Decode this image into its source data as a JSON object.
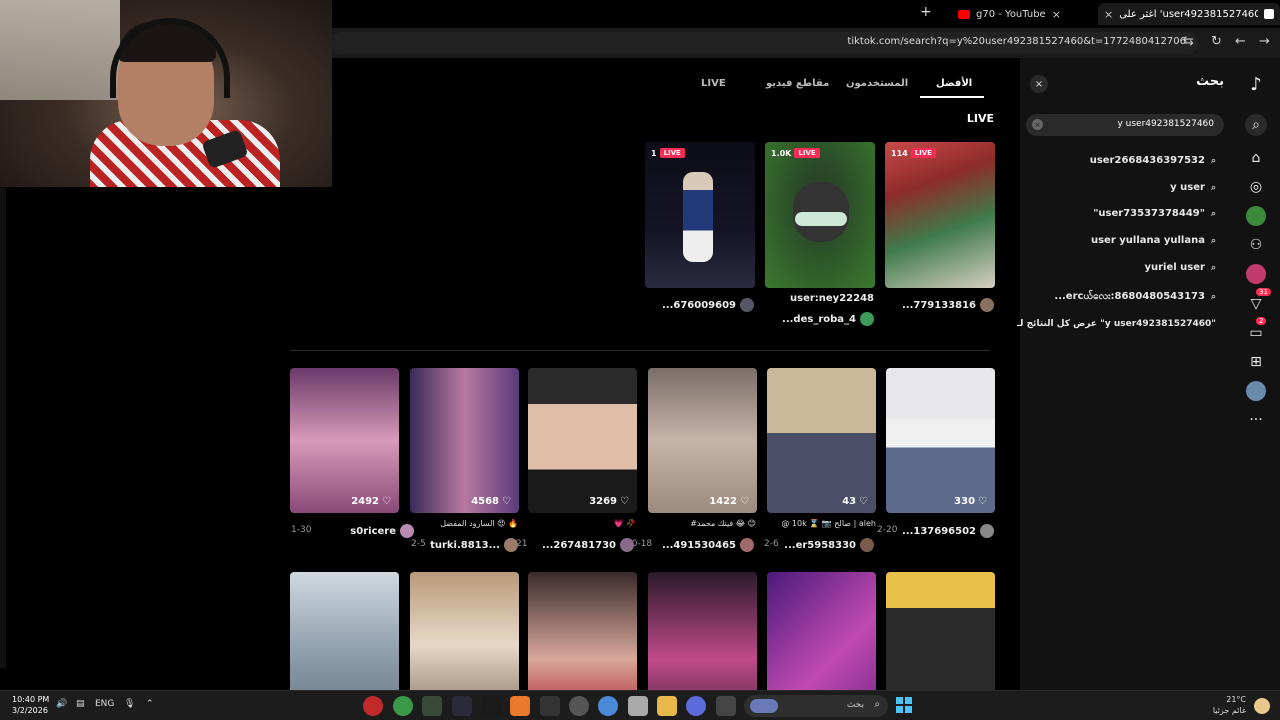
{
  "browser": {
    "tabs": [
      {
        "id": "tiktok",
        "label": "اغثر على 'user492381527460 y'"
      },
      {
        "id": "youtube",
        "label": "g70 - YouTube"
      }
    ],
    "new_tab_symbol": "+",
    "close_symbol": "×",
    "url": "tiktok.com/search?q=y%20user492381527460&t=1772480412706"
  },
  "search_panel": {
    "title": "بحث",
    "close_symbol": "×",
    "query": "y user492381527460",
    "clear_symbol": "×",
    "suggestions": [
      "user2668436397532",
      "y user",
      "\"user73537378449\"",
      "user yullana yullana",
      "yuriel user",
      "...ercယ်လေး:8680480543173"
    ],
    "see_all": "عرض كل النتائج لـ \"y user492381527460\""
  },
  "rail": {
    "messages_badge": "2",
    "inbox_badge": "31",
    "more_symbol": "···"
  },
  "main": {
    "tabs": [
      {
        "id": "top",
        "label": "الأفضل"
      },
      {
        "id": "users",
        "label": "المستخدمون"
      },
      {
        "id": "videos",
        "label": "مقاطع فيديو"
      },
      {
        "id": "live",
        "label": "LIVE"
      }
    ],
    "live_heading": "LIVE",
    "live_cards": [
      {
        "count": "114",
        "tag": "LIVE",
        "name": "...779133816"
      },
      {
        "count": "1.0K",
        "tag": "LIVE",
        "name": "user:ney22248",
        "name2": "...des_roba_4"
      },
      {
        "count": "1",
        "tag": "LIVE",
        "name": "...676009609"
      }
    ],
    "videos": [
      {
        "likes": "330",
        "caption": "",
        "user": "...137696502",
        "date": "2-20"
      },
      {
        "likes": "43",
        "caption": "@ 10k ⌛ 📷 صالح | aleh",
        "user": "...er5958330",
        "date": "2-6"
      },
      {
        "likes": "1422",
        "caption": "#فيتك محمد 😂 😊",
        "user": "...491530465",
        "date": "10-18"
      },
      {
        "likes": "3269",
        "caption": "💗 🥀",
        "user": "...267481730",
        "date": "8-21"
      },
      {
        "likes": "4568",
        "caption": "السارود المفضل 😍 🔥",
        "user": "turki.8813...",
        "date": "2-5"
      },
      {
        "likes": "2492",
        "caption": "",
        "user": "s0ricere",
        "date": "1-30"
      }
    ]
  },
  "taskbar": {
    "time": "10:40 PM",
    "date": "3/2/2026",
    "lang": "ENG",
    "search_label": "بحث",
    "temp": "21°C",
    "weather": "غائم جزئيا"
  }
}
